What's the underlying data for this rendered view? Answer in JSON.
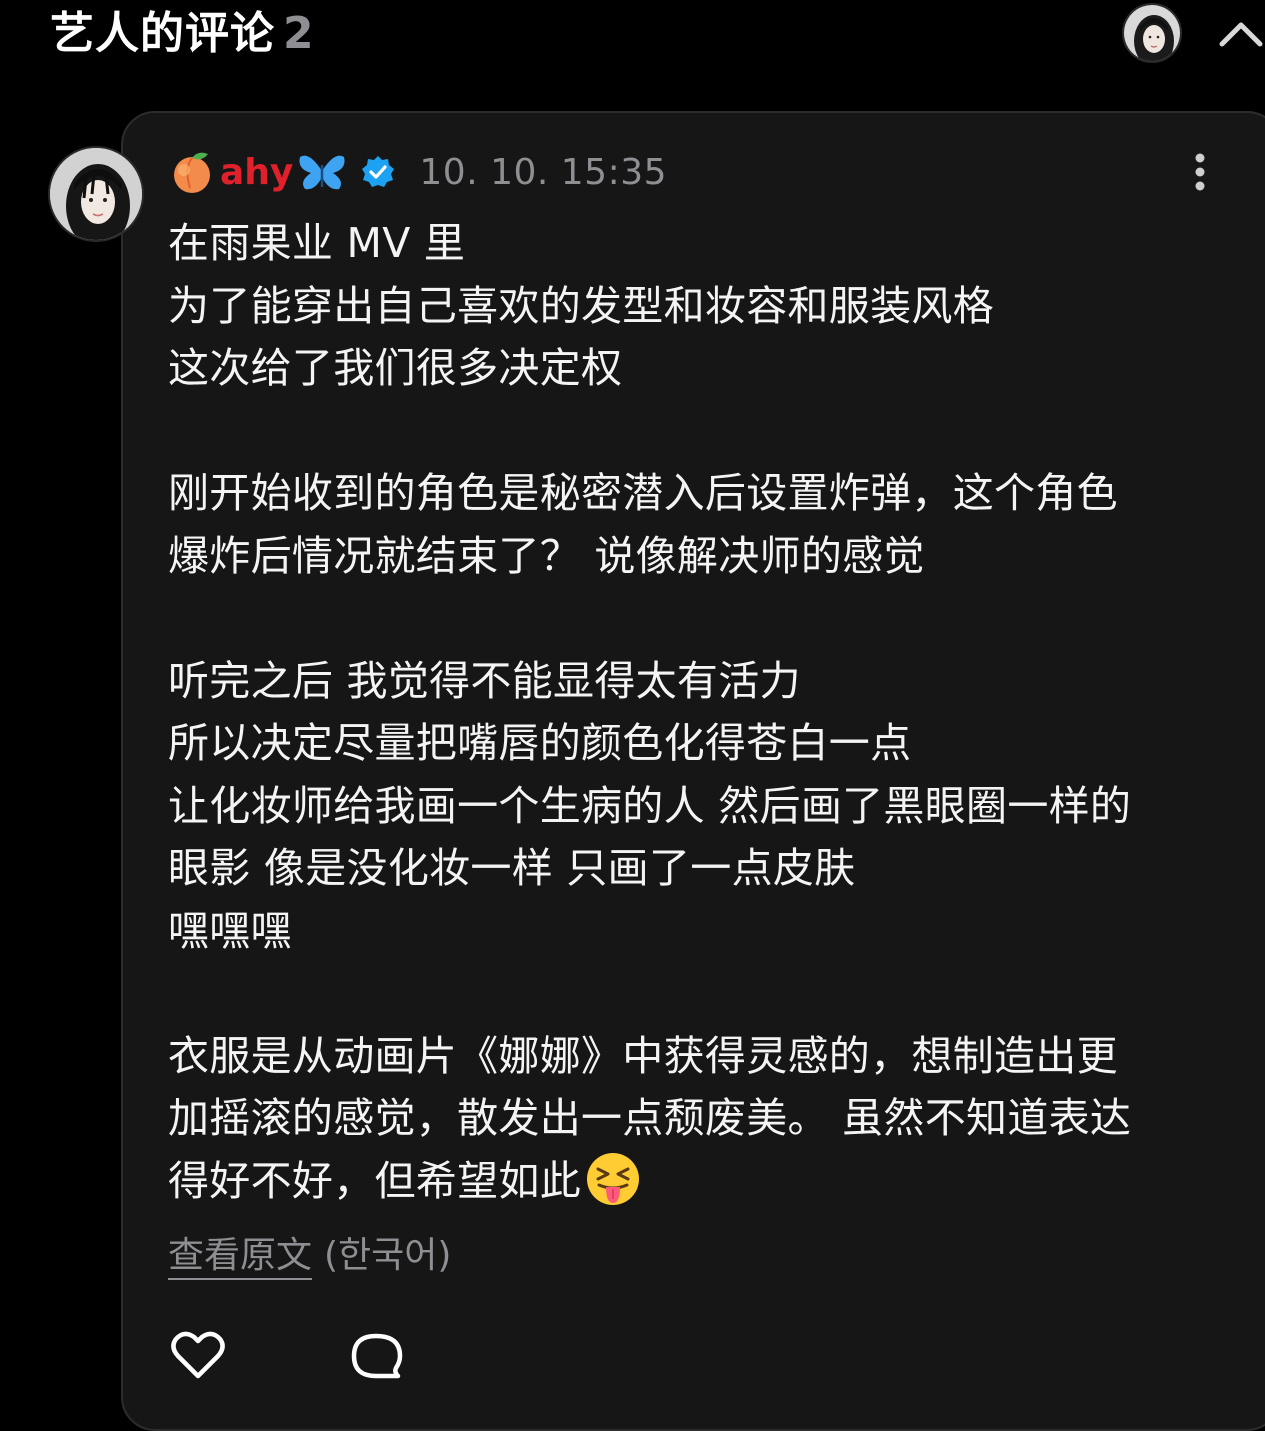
{
  "header": {
    "title": "艺人的评论",
    "count": "2"
  },
  "comment": {
    "username": "ahy",
    "timestamp": "10. 10. 15:35",
    "lines": [
      "在雨果业 MV 里",
      "为了能穿出自己喜欢的发型和妆容和服装风格",
      "这次给了我们很多决定权",
      "",
      "刚开始收到的角色是秘密潜入后设置炸弹，这个角色",
      "爆炸后情况就结束了？ 说像解决师的感觉",
      "",
      "听完之后 我觉得不能显得太有活力",
      "所以决定尽量把嘴唇的颜色化得苍白一点",
      "让化妆师给我画一个生病的人 然后画了黑眼圈一样的",
      "眼影 像是没化妆一样 只画了一点皮肤",
      "嘿嘿嘿",
      "",
      "衣服是从动画片《娜娜》中获得灵感的，想制造出更",
      "加摇滚的感觉，散发出一点颓废美。 虽然不知道表达",
      "得好不好，但希望如此"
    ],
    "see_original": "查看原文",
    "original_language": "(한국어)"
  },
  "icons": {
    "peach": "peach-emoji-icon",
    "butterfly": "butterfly-emoji-icon",
    "verified": "verified-badge-icon",
    "tongue_emoji": "squinting-tongue-emoji-icon",
    "more": "more-vertical-icon",
    "collapse": "chevron-up-icon",
    "like": "heart-icon",
    "reply": "speech-bubble-icon"
  },
  "colors": {
    "background": "#000000",
    "card": "#161616",
    "username": "#e0202a",
    "verified": "#1da1f2",
    "muted": "#8e8e93"
  }
}
